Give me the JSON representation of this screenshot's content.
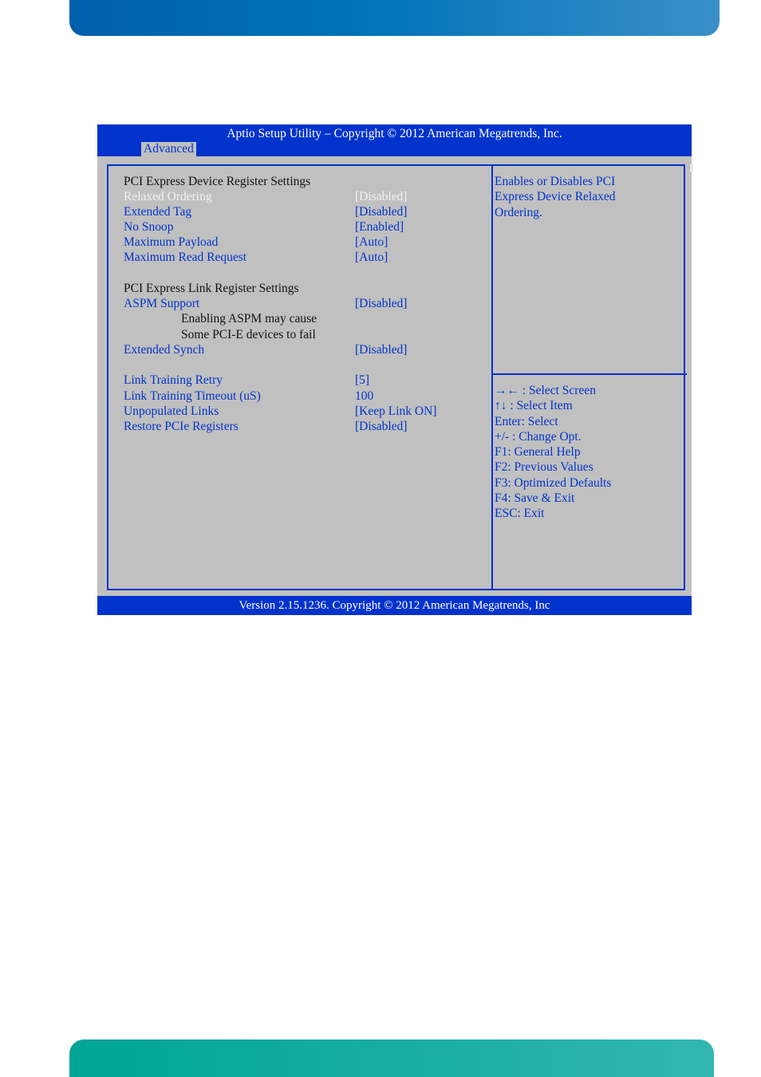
{
  "bios": {
    "title": "Aptio Setup Utility  –  Copyright © 2012 American Megatrends, Inc.",
    "active_tab": "Advanced",
    "footer": "Version 2.15.1236. Copyright © 2012 American Megatrends, Inc",
    "sections": [
      {
        "heading": "PCI Express Device Register Settings",
        "items": [
          {
            "label": "Relaxed Ordering",
            "value": "[Disabled]",
            "selected": true
          },
          {
            "label": "Extended Tag",
            "value": "[Disabled]"
          },
          {
            "label": "No Snoop",
            "value": "[Enabled]"
          },
          {
            "label": "Maximum Payload",
            "value": "[Auto]"
          },
          {
            "label": "Maximum Read Request",
            "value": "[Auto]"
          }
        ]
      },
      {
        "heading": "PCI Express Link Register Settings",
        "items": [
          {
            "label": "ASPM Support",
            "value": "[Disabled]"
          },
          {
            "label": "Extended Synch",
            "value": "[Disabled]"
          },
          {
            "label": "Link Training Retry",
            "value": "[5]"
          },
          {
            "label": "Link Training Timeout (uS)",
            "value": "100"
          },
          {
            "label": "Unpopulated Links",
            "value": "[Keep Link ON]"
          },
          {
            "label": "Restore PCIe Registers",
            "value": "[Disabled]"
          }
        ],
        "notes": [
          "Enabling ASPM may cause",
          "Some PCI-E devices to fail"
        ]
      }
    ],
    "help_text": [
      "Enables or Disables PCI",
      "Express Device Relaxed",
      "Ordering."
    ],
    "key_help": [
      "→← : Select Screen",
      "↑↓ : Select Item",
      "Enter: Select",
      "+/- : Change Opt.",
      "F1: General Help",
      "F2: Previous Values",
      "F3: Optimized Defaults",
      "F4: Save & Exit",
      "ESC: Exit"
    ]
  },
  "colors": {
    "bios_blue": "#0033cc",
    "bios_gray": "#c0c0c0",
    "selected_text": "#f2f2f2",
    "page_header": "#0073ba",
    "page_footer": "#17ada4"
  }
}
